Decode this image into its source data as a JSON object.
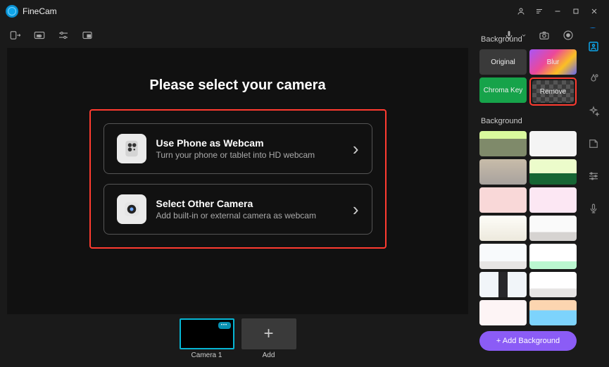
{
  "app": {
    "name": "FineCam"
  },
  "main": {
    "heading": "Please select your camera",
    "options": [
      {
        "title": "Use Phone as Webcam",
        "subtitle": "Turn your phone or tablet into HD webcam"
      },
      {
        "title": "Select Other Camera",
        "subtitle": "Add built-in or external camera as webcam"
      }
    ]
  },
  "scenes": {
    "items": [
      {
        "label": "Camera 1"
      }
    ],
    "add_label": "Add"
  },
  "panel": {
    "effects_header": "Background",
    "effects": {
      "original": "Original",
      "blur": "Blur",
      "chroma": "Chroma Key",
      "remove": "Remove"
    },
    "backgrounds_header": "Background",
    "add_button": "+ Add Background"
  }
}
